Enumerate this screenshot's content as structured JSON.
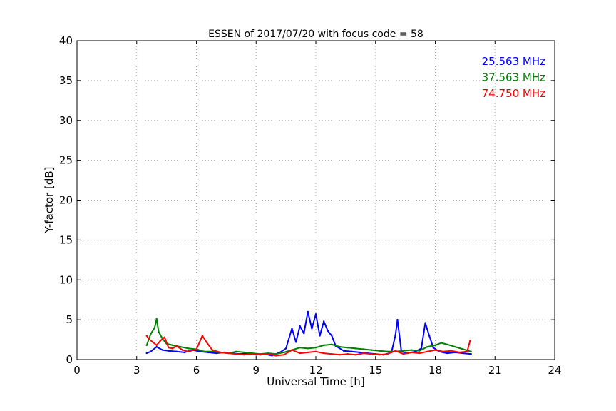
{
  "chart_data": {
    "type": "line",
    "title": "ESSEN of 2017/07/20 with focus code = 58",
    "xlabel": "Universal Time [h]",
    "ylabel": "Y-factor [dB]",
    "xlim": [
      0,
      24
    ],
    "ylim": [
      0,
      40
    ],
    "xticks": [
      0,
      3,
      6,
      9,
      12,
      15,
      18,
      21,
      24
    ],
    "yticks": [
      0,
      5,
      10,
      15,
      20,
      25,
      30,
      35,
      40
    ],
    "grid": true,
    "legend_position": "top-right",
    "series": [
      {
        "name": "25.563 MHz",
        "color": "#0000ff",
        "x": [
          3.5,
          3.7,
          4.0,
          4.3,
          4.6,
          5.0,
          5.4,
          5.8,
          6.2,
          6.6,
          7.0,
          7.4,
          7.8,
          8.2,
          8.6,
          9.0,
          9.4,
          9.8,
          10.2,
          10.5,
          10.8,
          11.0,
          11.2,
          11.4,
          11.6,
          11.8,
          12.0,
          12.2,
          12.4,
          12.6,
          12.8,
          13.0,
          13.4,
          13.8,
          14.2,
          14.6,
          15.0,
          15.4,
          15.8,
          16.0,
          16.1,
          16.3,
          16.6,
          17.0,
          17.3,
          17.5,
          17.7,
          17.9,
          18.2,
          18.6,
          19.0,
          19.4,
          19.8
        ],
        "y": [
          0.8,
          1.0,
          1.6,
          1.2,
          1.1,
          1.0,
          0.9,
          1.2,
          1.0,
          0.9,
          0.8,
          0.9,
          0.8,
          0.7,
          0.8,
          0.6,
          0.7,
          0.5,
          0.9,
          1.4,
          3.9,
          2.2,
          4.2,
          3.3,
          6.0,
          3.9,
          5.7,
          3.0,
          4.8,
          3.6,
          3.0,
          1.7,
          1.1,
          1.0,
          0.9,
          0.8,
          0.7,
          0.6,
          0.9,
          3.1,
          5.0,
          1.0,
          0.8,
          1.0,
          1.4,
          4.6,
          3.0,
          1.5,
          1.0,
          0.8,
          0.9,
          0.8,
          0.7
        ]
      },
      {
        "name": "37.563 MHz",
        "color": "#008000",
        "x": [
          3.5,
          3.7,
          3.9,
          4.0,
          4.1,
          4.3,
          4.5,
          4.8,
          5.2,
          5.6,
          6.0,
          6.4,
          6.8,
          7.2,
          7.6,
          8.0,
          8.4,
          8.8,
          9.2,
          9.6,
          10.0,
          10.4,
          10.8,
          11.2,
          11.6,
          12.0,
          12.4,
          12.8,
          13.2,
          13.6,
          14.0,
          14.4,
          14.8,
          15.2,
          15.6,
          16.0,
          16.4,
          16.8,
          17.2,
          17.6,
          18.0,
          18.3,
          18.6,
          19.0,
          19.4,
          19.8
        ],
        "y": [
          1.8,
          3.2,
          4.0,
          5.1,
          3.5,
          2.6,
          2.0,
          1.8,
          1.6,
          1.4,
          1.3,
          1.0,
          1.0,
          0.9,
          0.8,
          1.0,
          0.9,
          0.8,
          0.7,
          0.8,
          0.7,
          0.9,
          1.2,
          1.5,
          1.4,
          1.5,
          1.8,
          1.9,
          1.6,
          1.5,
          1.4,
          1.3,
          1.2,
          1.1,
          1.0,
          1.0,
          1.1,
          1.2,
          1.1,
          1.6,
          1.8,
          2.1,
          1.9,
          1.6,
          1.3,
          1.0
        ]
      },
      {
        "name": "74.750 MHz",
        "color": "#ff0000",
        "x": [
          3.5,
          3.6,
          3.8,
          4.0,
          4.2,
          4.4,
          4.6,
          4.8,
          5.0,
          5.3,
          5.6,
          6.0,
          6.3,
          6.5,
          6.8,
          7.2,
          7.6,
          8.0,
          8.4,
          8.8,
          9.2,
          9.6,
          10.0,
          10.4,
          10.8,
          11.2,
          11.6,
          12.0,
          12.4,
          12.8,
          13.2,
          13.6,
          14.0,
          14.4,
          14.8,
          15.2,
          15.6,
          16.0,
          16.4,
          16.8,
          17.2,
          17.6,
          18.0,
          18.4,
          18.8,
          19.2,
          19.6,
          19.75
        ],
        "y": [
          3.0,
          2.6,
          2.2,
          1.8,
          2.4,
          2.8,
          1.5,
          1.4,
          1.7,
          1.2,
          1.0,
          1.3,
          3.0,
          2.2,
          1.2,
          0.9,
          0.8,
          0.7,
          0.6,
          0.7,
          0.6,
          0.7,
          0.5,
          0.6,
          1.2,
          0.8,
          0.9,
          1.0,
          0.8,
          0.7,
          0.6,
          0.7,
          0.6,
          0.8,
          0.7,
          0.6,
          0.7,
          1.1,
          0.7,
          0.9,
          0.8,
          1.0,
          1.2,
          1.0,
          1.1,
          0.9,
          1.0,
          2.4
        ]
      }
    ]
  }
}
